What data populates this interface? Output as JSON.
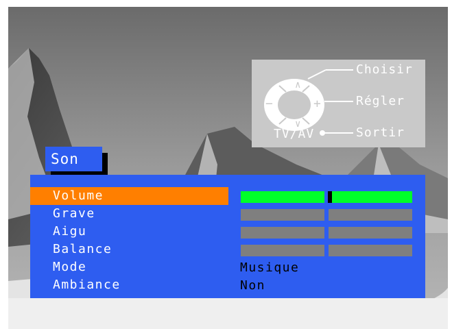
{
  "helper": {
    "choose_label": "Choisir",
    "adjust_label": "Régler",
    "exit_label": "Sortir",
    "tvav_label": "TV/AV",
    "minus_symbol": "−",
    "plus_symbol": "+",
    "up_symbol": "∧",
    "down_symbol": "∨"
  },
  "menu": {
    "title": "Son",
    "items": [
      {
        "label": "Volume",
        "type": "slider",
        "level": 0.52,
        "selected": true
      },
      {
        "label": "Grave",
        "type": "slider",
        "level": 0.5,
        "selected": false
      },
      {
        "label": "Aigu",
        "type": "slider",
        "level": 0.5,
        "selected": false
      },
      {
        "label": "Balance",
        "type": "slider",
        "level": 0.5,
        "selected": false
      },
      {
        "label": "Mode",
        "type": "value",
        "value": "Musique",
        "selected": false
      },
      {
        "label": "Ambiance",
        "type": "value",
        "value": "Non",
        "selected": false
      }
    ]
  },
  "colors": {
    "panel": "#2e5df0",
    "highlight": "#ff7f00",
    "active_bar": "#00ff2a",
    "inactive_bar": "#7f7f7f"
  }
}
